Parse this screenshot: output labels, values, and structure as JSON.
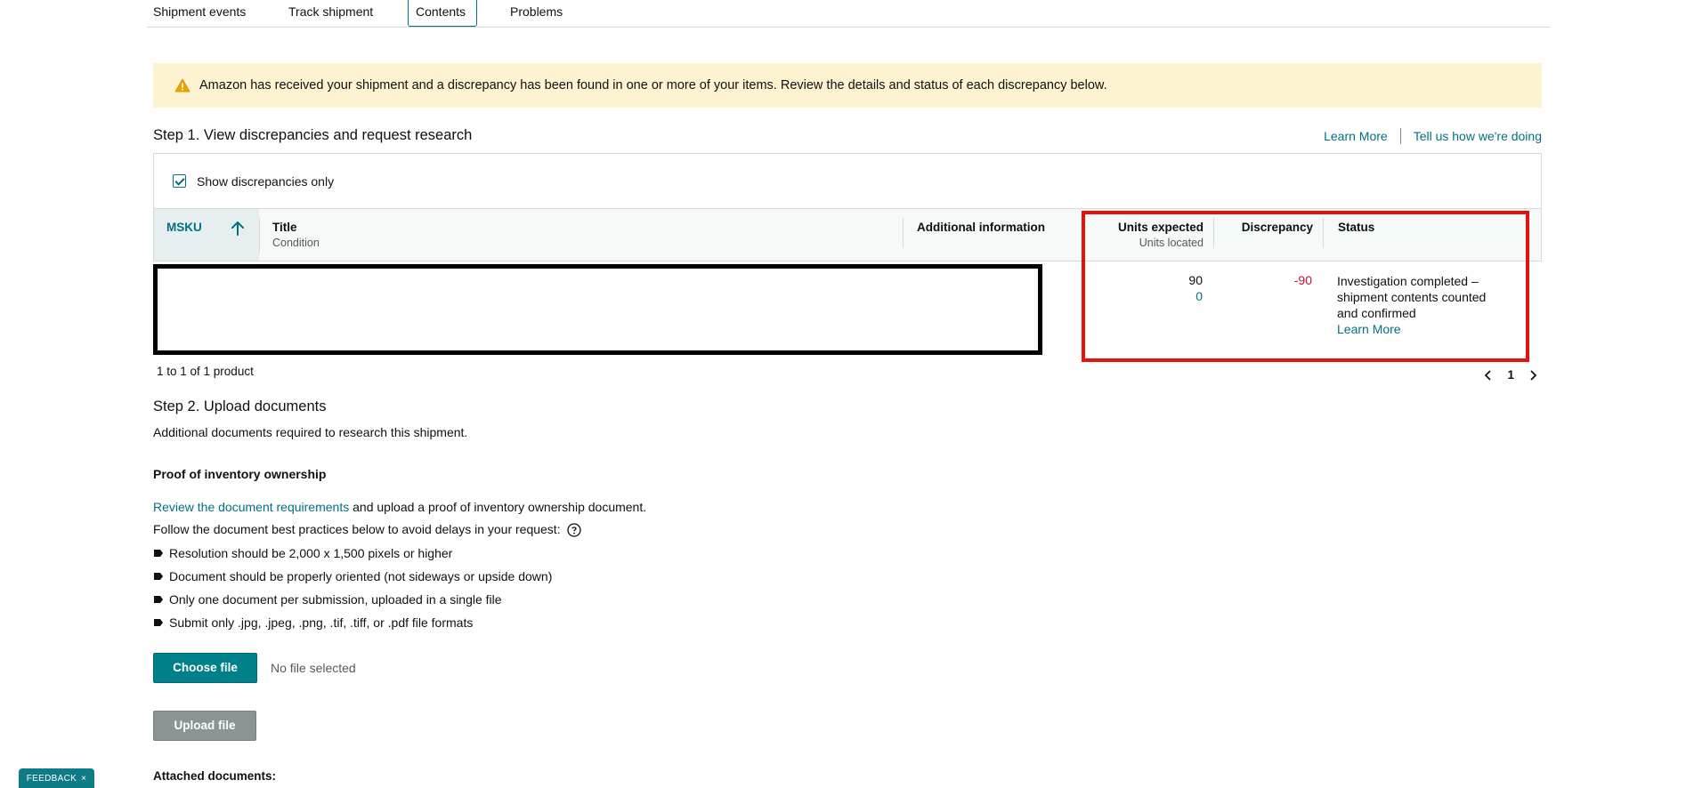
{
  "tabs": [
    {
      "label": "Shipment events"
    },
    {
      "label": "Track shipment"
    },
    {
      "label": "Contents"
    },
    {
      "label": "Problems"
    }
  ],
  "alert": {
    "text": "Amazon has received your shipment and a discrepancy has been found in one or more of your items. Review the details and status of each discrepancy below."
  },
  "step1": {
    "title": "Step 1. View discrepancies and request research",
    "learn_more": "Learn More",
    "feedback_link": "Tell us how we're doing",
    "filter_label": "Show discrepancies only",
    "filter_checked": true
  },
  "table": {
    "headers": {
      "msku": "MSKU",
      "title": "Title",
      "title_sub": "Condition",
      "additional": "Additional information",
      "units_expected": "Units expected",
      "units_located": "Units located",
      "discrepancy": "Discrepancy",
      "status": "Status"
    },
    "row": {
      "units_expected": "90",
      "units_located": "0",
      "discrepancy": "-90",
      "status_lines": [
        "Investigation completed –",
        "shipment contents counted",
        "and confirmed"
      ],
      "status_link": "Learn More"
    },
    "count_text": "1 to 1 of 1 product",
    "page": "1"
  },
  "step2": {
    "title": "Step 2. Upload documents",
    "subtitle": "Additional documents required to research this shipment.",
    "proof_heading": "Proof of inventory ownership",
    "review_link": "Review the document requirements",
    "review_rest": " and upload a proof of inventory ownership document.",
    "best_practices": "Follow the document best practices below to avoid delays in your request:",
    "bullets": [
      "Resolution should be 2,000 x 1,500 pixels or higher",
      "Document should be properly oriented (not sideways or upside down)",
      "Only one document per submission, uploaded in a single file",
      "Submit only .jpg, .jpeg, .png, .tif, .tiff, or .pdf file formats"
    ],
    "choose_file": "Choose file",
    "no_file": "No file selected",
    "upload_file": "Upload file",
    "attached": "Attached documents:"
  },
  "feedback_tab": {
    "label": "FEEDBACK",
    "close": "×"
  },
  "colors": {
    "link": "#007185",
    "alert_bg": "#fdf3d0",
    "discrepancy": "#cc0c39",
    "highlight_box": "#e80f0f",
    "primary_button": "#00808a"
  },
  "icons": [
    "warning-icon",
    "sort-up-arrow-icon",
    "chevron-left-icon",
    "chevron-right-icon",
    "help-circle-icon",
    "tag-bullet-icon",
    "checkmark-icon"
  ]
}
